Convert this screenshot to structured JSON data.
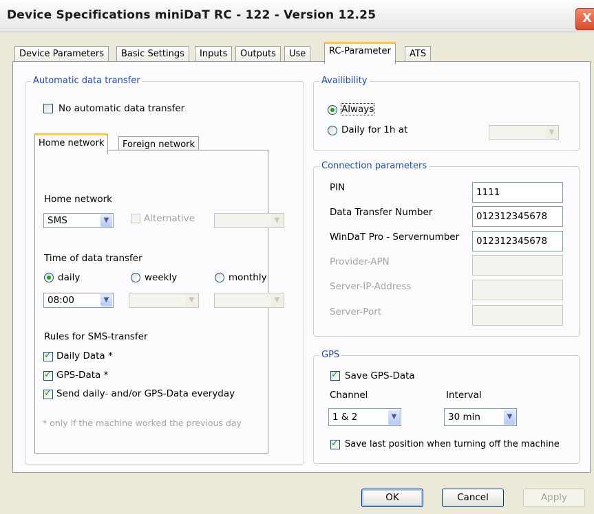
{
  "window": {
    "title": "Device Specifications miniDaT RC - 122 - Version 12.25",
    "close_glyph": "X"
  },
  "tabs": [
    "Device Parameters",
    "Basic Settings",
    "Inputs",
    "Outputs",
    "Use",
    "RC-Parameter",
    "ATS"
  ],
  "auto_transfer": {
    "label": "Automatic data transfer",
    "no_auto_label": "No automatic data transfer",
    "no_auto_checked": false,
    "inner_tabs": [
      "Home network",
      "Foreign network"
    ],
    "home_network_label": "Home network",
    "network_value": "SMS",
    "alternative_label": "Alternative",
    "alternative_checked": false,
    "time_label": "Time of data transfer",
    "freq_options": [
      "daily",
      "weekly",
      "monthly"
    ],
    "freq_selected": "daily",
    "time_value": "08:00",
    "rules_label": "Rules for SMS-transfer",
    "rules": [
      {
        "label": "Daily Data *",
        "checked": true
      },
      {
        "label": "GPS-Data *",
        "checked": true
      },
      {
        "label": "Send daily- and/or GPS-Data everyday",
        "checked": true
      }
    ],
    "footnote": "* only if the machine worked the previous day"
  },
  "availability": {
    "label": "Availibility",
    "options": [
      "Always",
      "Daily for 1h at"
    ],
    "selected": "Always"
  },
  "connection": {
    "label": "Connection parameters",
    "fields": [
      {
        "label": "PIN",
        "value": "1111",
        "enabled": true
      },
      {
        "label": "Data Transfer Number",
        "value": "012312345678",
        "enabled": true
      },
      {
        "label": "WinDaT Pro - Servernumber",
        "value": "012312345678",
        "enabled": true
      },
      {
        "label": "Provider-APN",
        "value": "",
        "enabled": false
      },
      {
        "label": "Server-IP-Address",
        "value": "",
        "enabled": false
      },
      {
        "label": "Server-Port",
        "value": "",
        "enabled": false
      }
    ]
  },
  "gps": {
    "label": "GPS",
    "save_label": "Save GPS-Data",
    "save_checked": true,
    "channel_label": "Channel",
    "channel_value": "1 & 2",
    "interval_label": "Interval",
    "interval_value": "30 min",
    "save_last_label": "Save last position when turning off the machine",
    "save_last_checked": true
  },
  "buttons": {
    "ok": "OK",
    "cancel": "Cancel",
    "apply": "Apply"
  },
  "icons": {
    "dropdown_arrow": "chevron-down-icon",
    "close": "close-icon"
  }
}
